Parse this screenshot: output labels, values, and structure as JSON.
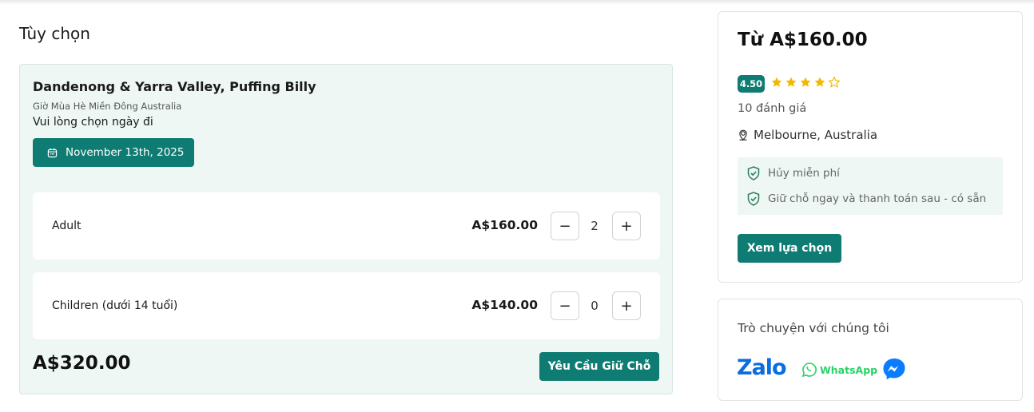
{
  "section_title": "Tùy chọn",
  "option": {
    "name": "Dandenong & Yarra Valley, Puffing Billy",
    "timezone": "Giờ Mùa Hè Miền Đông Australia",
    "choose_date": "Vui lòng chọn ngày đi",
    "date": "November 13th, 2025",
    "rows": [
      {
        "label": "Adult",
        "price": "A$160.00",
        "qty": "2",
        "minus": "−",
        "plus": "+"
      },
      {
        "label": "Children (dưới 14 tuổi)",
        "price": "A$140.00",
        "qty": "0",
        "minus": "−",
        "plus": "+"
      }
    ],
    "total": "A$320.00",
    "hold_button": "Yêu Cầu Giữ Chỗ"
  },
  "summary": {
    "from_price": "Từ A$160.00",
    "rating": "4.50",
    "stars_filled": 4,
    "stars_total": 5,
    "reviews": "10 đánh giá",
    "location": "Melbourne, Australia",
    "features": [
      "Hủy miễn phí",
      "Giữ chỗ ngay và thanh toán sau - có sẵn"
    ],
    "options_button": "Xem lựa chọn"
  },
  "chat": {
    "title": "Trò chuyện với chúng tôi",
    "zalo": "Zalo",
    "whatsapp": "WhatsApp",
    "icons": [
      "zalo-icon",
      "whatsapp-icon",
      "messenger-icon"
    ]
  },
  "colors": {
    "accent": "#0e7c72",
    "panel_bg": "#eef7f3",
    "star": "#f5b800",
    "zalo": "#0a6ee0",
    "whatsapp": "#25d366",
    "messenger": "#0a7cff"
  }
}
